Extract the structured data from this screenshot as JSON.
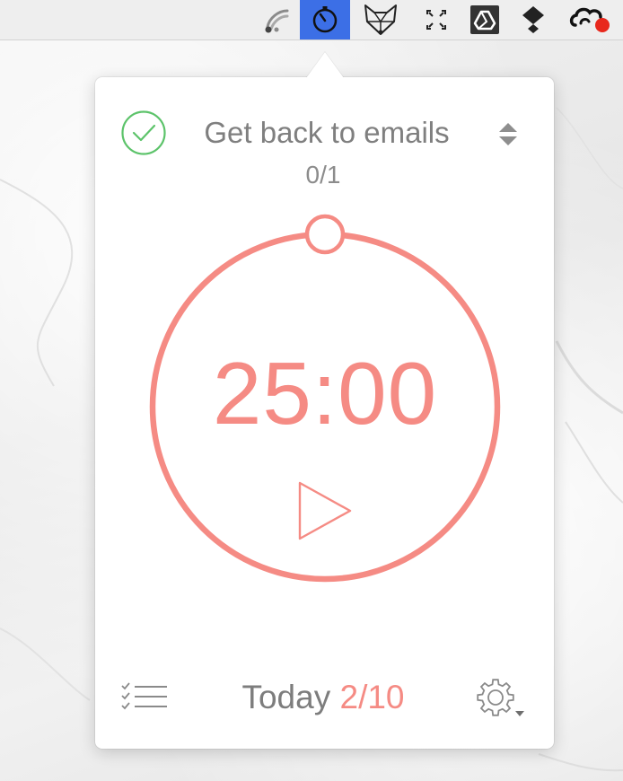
{
  "menubar": {
    "items": [
      {
        "icon": "cloud-sync-icon",
        "active": false
      },
      {
        "icon": "pomodoro-timer-icon",
        "active": true
      },
      {
        "icon": "fox-mask-icon",
        "active": false
      },
      {
        "icon": "expand-arrows-icon",
        "active": false
      },
      {
        "icon": "google-drive-icon",
        "active": false
      },
      {
        "icon": "dropbox-icon",
        "active": false
      },
      {
        "icon": "creative-cloud-icon",
        "active": false
      }
    ],
    "active_color": "#3c6fe6"
  },
  "task": {
    "title": "Get back to emails",
    "progress": "0/1",
    "done_icon": "check-circle-icon",
    "check_color": "#5cc36a"
  },
  "timer": {
    "time": "25:00",
    "accent_color": "#f58b84",
    "progress_fraction": 0
  },
  "footer": {
    "today_label": "Today",
    "today_count": "2/10",
    "list_icon": "task-list-icon",
    "settings_icon": "gear-icon"
  }
}
